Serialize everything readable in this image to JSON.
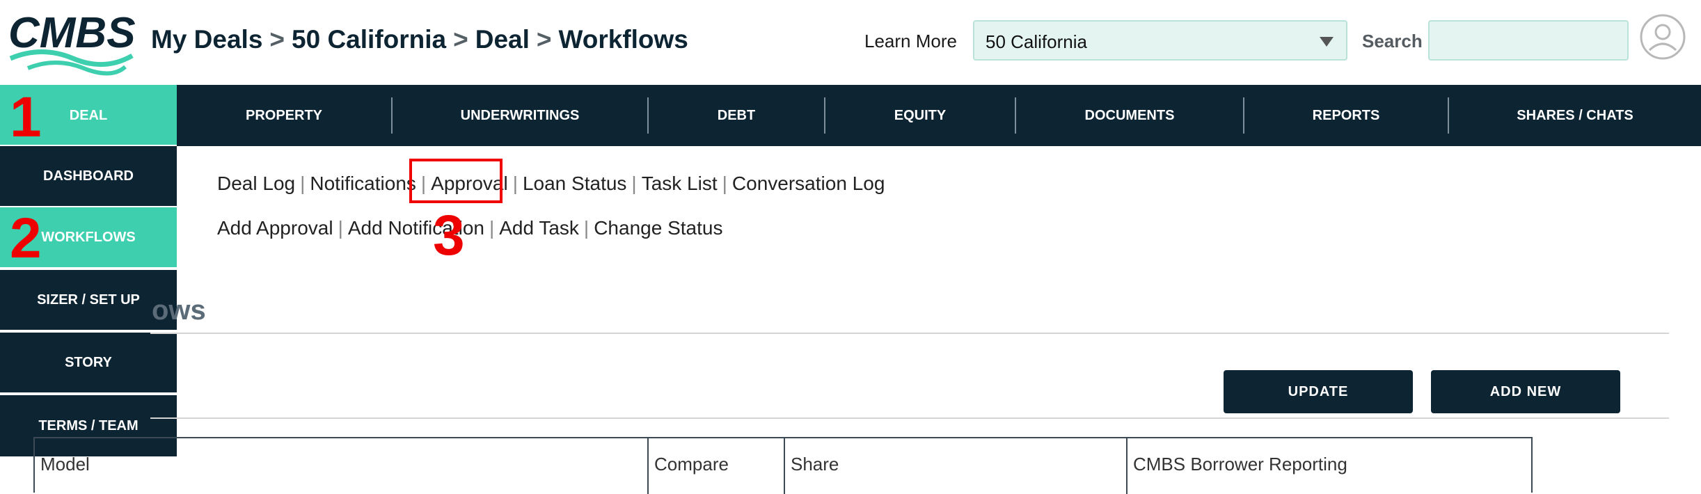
{
  "header": {
    "logo_text": "CMBS",
    "breadcrumb": [
      "My Deals",
      "50 California",
      "Deal",
      "Workflows"
    ],
    "breadcrumb_sep": ">",
    "learn_more": "Learn More",
    "deal_select_value": "50 California",
    "search_label": "Search",
    "search_value": ""
  },
  "topnav": {
    "items": [
      "DEAL",
      "PROPERTY",
      "UNDERWRITINGS",
      "DEBT",
      "EQUITY",
      "DOCUMENTS",
      "REPORTS",
      "SHARES / CHATS"
    ],
    "active": "DEAL"
  },
  "sidenav": {
    "items": [
      "DASHBOARD",
      "WORKFLOWS",
      "SIZER / SET UP",
      "STORY",
      "TERMS / TEAM"
    ],
    "active": "WORKFLOWS"
  },
  "sublinks": {
    "row1": [
      "Deal Log",
      "Notifications",
      "Approval",
      "Loan Status",
      "Task List",
      "Conversation Log"
    ],
    "row2": [
      "Add Approval",
      "Add Notification",
      "Add Task",
      "Change Status"
    ],
    "separator": "|"
  },
  "annotations": [
    "1",
    "2",
    "3"
  ],
  "section": {
    "title_visible": "ows"
  },
  "buttons": {
    "update": "UPDATE",
    "add_new": "ADD NEW"
  },
  "table": {
    "columns": [
      "Model",
      "Compare",
      "Share",
      "CMBS Borrower Reporting"
    ]
  },
  "colors": {
    "navy": "#0d2433",
    "teal": "#3ecfae",
    "input_bg": "#e4f5f1",
    "annotation_red": "#ee0000"
  }
}
